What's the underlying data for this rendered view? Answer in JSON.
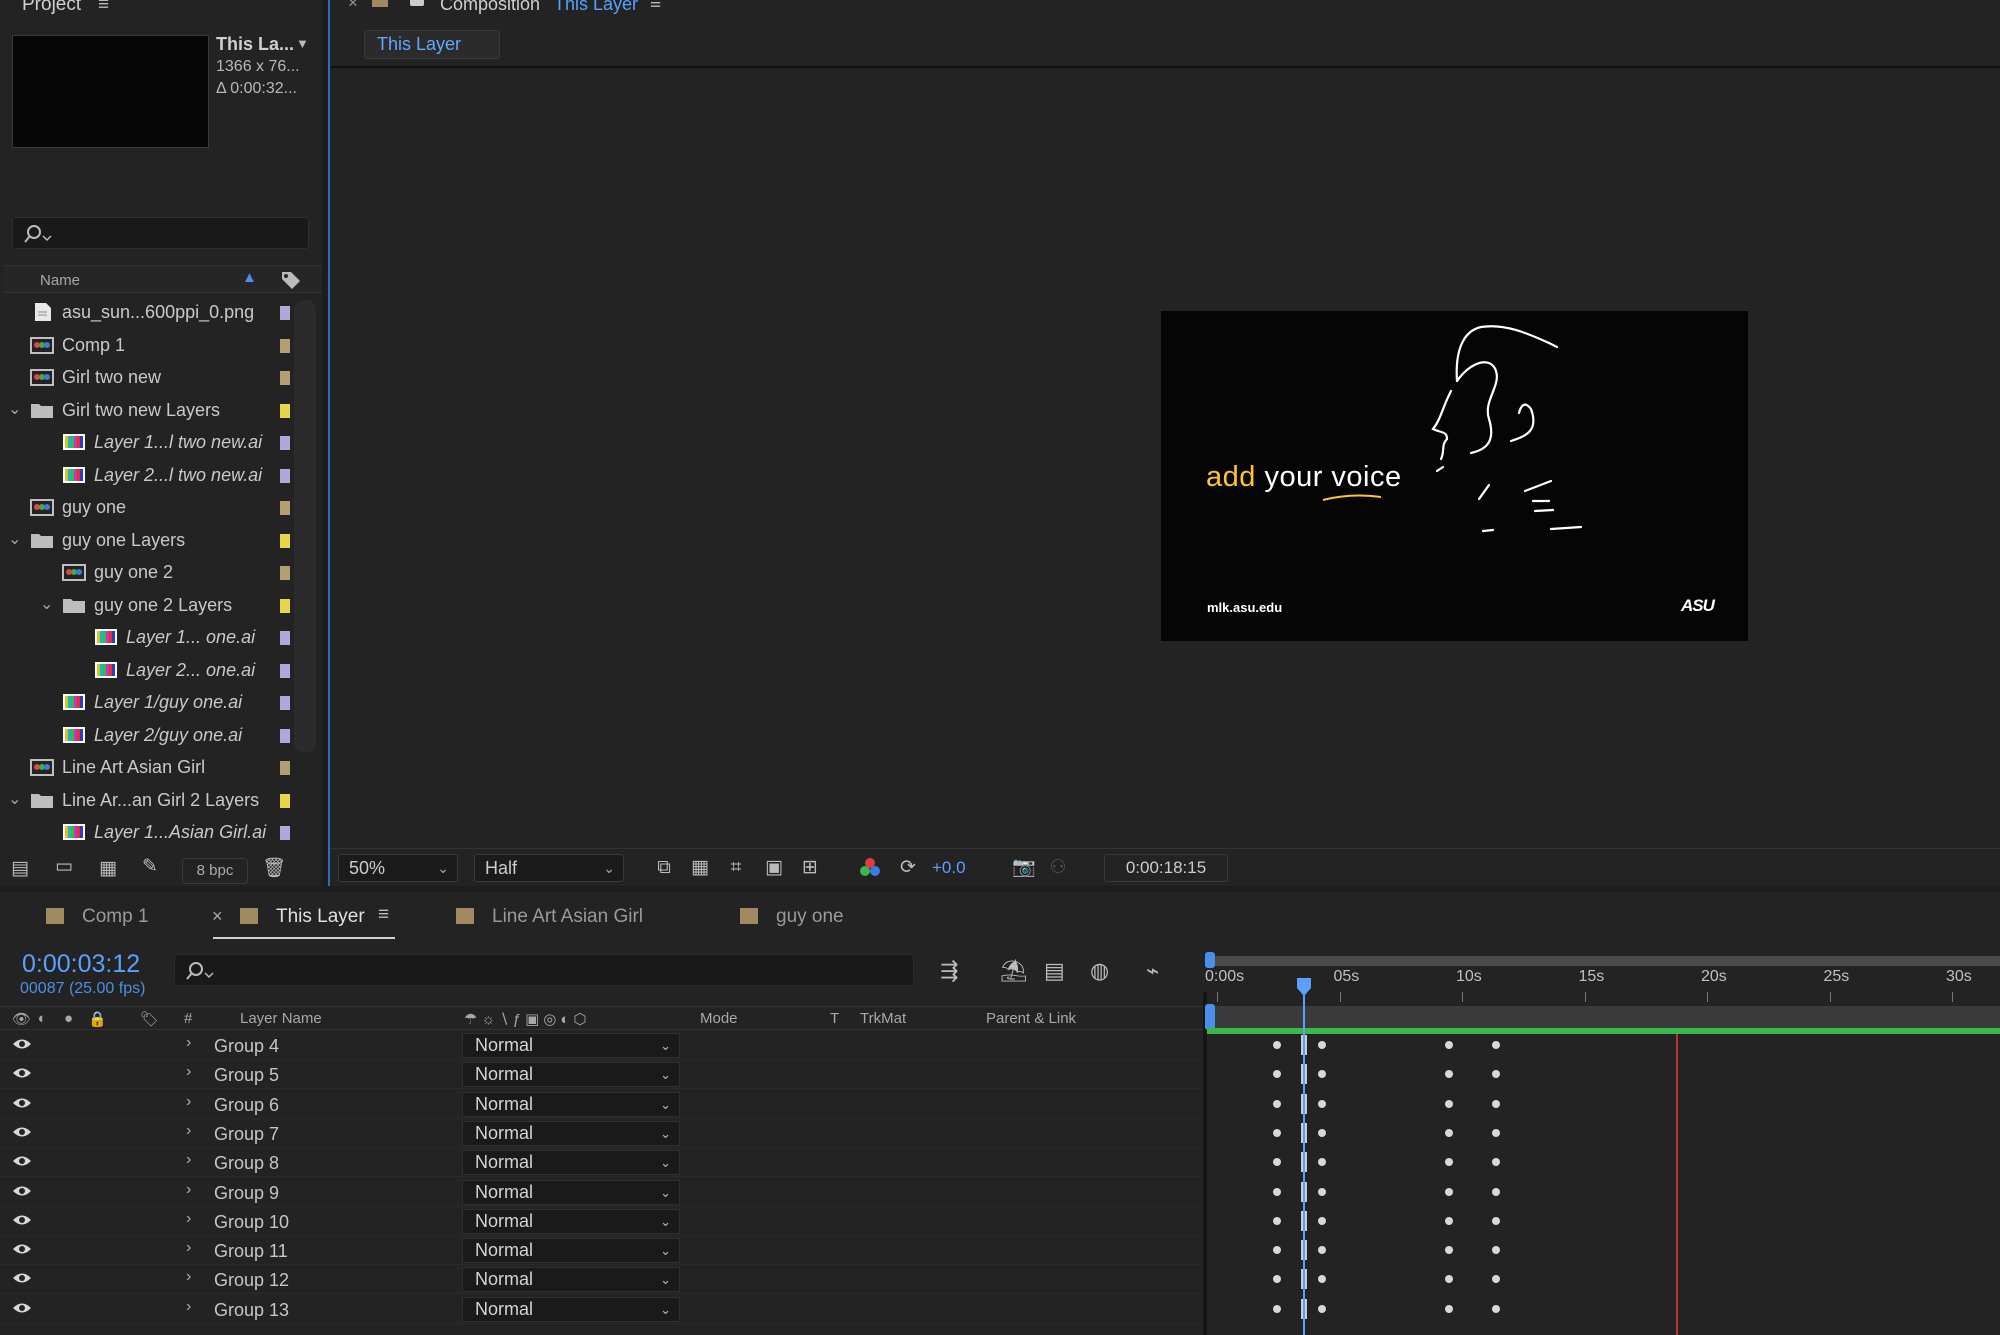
{
  "project": {
    "title": "Project",
    "selected_name": "This La...",
    "selected_dims": "1366 x 76...",
    "selected_duration": "Δ 0:00:32...",
    "col_name": "Name",
    "items": [
      {
        "label": "asu_sun...600ppi_0.png",
        "type": "file",
        "indent": 0,
        "italic": false,
        "swatch": "#b0a8d8"
      },
      {
        "label": "Comp 1",
        "type": "comp",
        "indent": 0,
        "italic": false,
        "swatch": "#b49e73"
      },
      {
        "label": "Girl two new",
        "type": "comp",
        "indent": 0,
        "italic": false,
        "swatch": "#b49e73"
      },
      {
        "label": "Girl two new Layers",
        "type": "folder",
        "indent": 0,
        "italic": false,
        "swatch": "#e6d84a",
        "expanded": true
      },
      {
        "label": "Layer 1...l two new.ai",
        "type": "ai",
        "indent": 1,
        "italic": true,
        "swatch": "#b0a8d8"
      },
      {
        "label": "Layer 2...l two new.ai",
        "type": "ai",
        "indent": 1,
        "italic": true,
        "swatch": "#b0a8d8"
      },
      {
        "label": "guy one",
        "type": "comp",
        "indent": 0,
        "italic": false,
        "swatch": "#b49e73"
      },
      {
        "label": "guy one Layers",
        "type": "folder",
        "indent": 0,
        "italic": false,
        "swatch": "#e6d84a",
        "expanded": true
      },
      {
        "label": "guy one 2",
        "type": "comp",
        "indent": 1,
        "italic": false,
        "swatch": "#b49e73"
      },
      {
        "label": "guy one 2 Layers",
        "type": "folder",
        "indent": 1,
        "italic": false,
        "swatch": "#e6d84a",
        "expanded": true
      },
      {
        "label": "Layer 1... one.ai",
        "type": "ai",
        "indent": 2,
        "italic": true,
        "swatch": "#b0a8d8"
      },
      {
        "label": "Layer 2... one.ai",
        "type": "ai",
        "indent": 2,
        "italic": true,
        "swatch": "#b0a8d8"
      },
      {
        "label": "Layer 1/guy one.ai",
        "type": "ai",
        "indent": 1,
        "italic": true,
        "swatch": "#b0a8d8"
      },
      {
        "label": "Layer 2/guy one.ai",
        "type": "ai",
        "indent": 1,
        "italic": true,
        "swatch": "#b0a8d8"
      },
      {
        "label": "Line Art Asian Girl",
        "type": "comp",
        "indent": 0,
        "italic": false,
        "swatch": "#b49e73"
      },
      {
        "label": "Line Ar...an Girl 2 Layers",
        "type": "folder",
        "indent": 0,
        "italic": false,
        "swatch": "#e6d84a",
        "expanded": true
      },
      {
        "label": "Layer 1...Asian Girl.ai",
        "type": "ai",
        "indent": 1,
        "italic": true,
        "swatch": "#b0a8d8"
      }
    ],
    "bpc": "8 bpc"
  },
  "composition": {
    "tab_title": "Composition",
    "tab_comp_name": "This Layer",
    "subtab": "This Layer",
    "frame": {
      "headline_yellow": "add",
      "headline_white": "your voice",
      "url": "mlk.asu.edu",
      "logo": "ASU"
    },
    "toolbar": {
      "zoom": "50%",
      "resolution": "Half",
      "exposure": "+0.0",
      "timecode": "0:00:18:15"
    }
  },
  "timeline": {
    "tabs": [
      "Comp 1",
      "This Layer",
      "Line Art Asian Girl",
      "guy one"
    ],
    "active_tab": "This Layer",
    "current_time": "0:00:03:12",
    "frame_info": "00087 (25.00 fps)",
    "columns": {
      "hash": "#",
      "layer_name": "Layer Name",
      "mode": "Mode",
      "t": "T",
      "trkmat": "TrkMat",
      "parent": "Parent & Link"
    },
    "ruler": [
      "0:00s",
      "05s",
      "10s",
      "15s",
      "20s",
      "25s",
      "30s"
    ],
    "layers": [
      {
        "name": "Group 4",
        "mode": "Normal"
      },
      {
        "name": "Group 5",
        "mode": "Normal"
      },
      {
        "name": "Group 6",
        "mode": "Normal"
      },
      {
        "name": "Group 7",
        "mode": "Normal"
      },
      {
        "name": "Group 8",
        "mode": "Normal"
      },
      {
        "name": "Group 9",
        "mode": "Normal"
      },
      {
        "name": "Group 10",
        "mode": "Normal"
      },
      {
        "name": "Group 11",
        "mode": "Normal"
      },
      {
        "name": "Group 12",
        "mode": "Normal"
      },
      {
        "name": "Group 13",
        "mode": "Normal"
      }
    ]
  },
  "colors": {
    "accent_blue": "#5aa0ff",
    "comp_label": "#a18962",
    "asu_gold": "#ffc627",
    "work_area_green": "#3bb84a",
    "end_marker_red": "#c03030"
  }
}
